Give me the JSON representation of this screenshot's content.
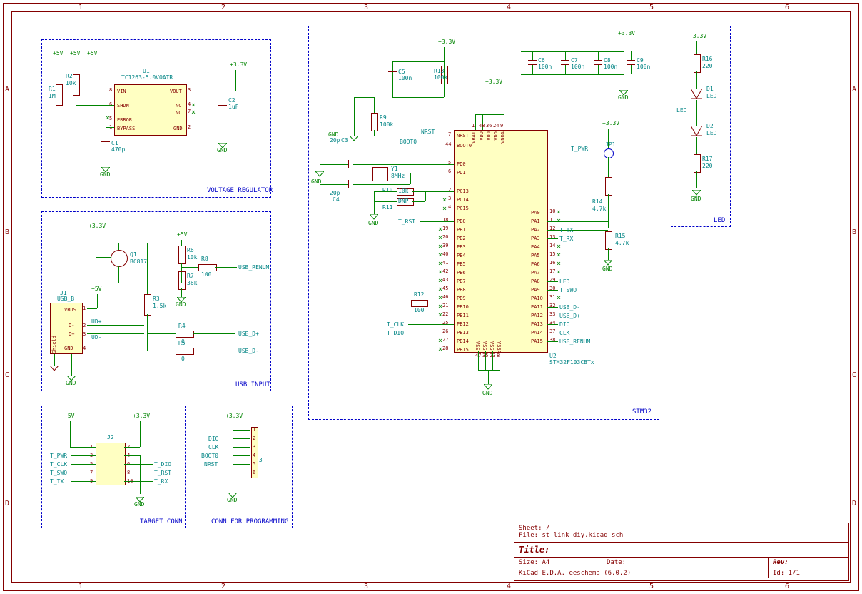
{
  "ruler": {
    "cols": [
      "1",
      "2",
      "3",
      "4",
      "5",
      "6"
    ],
    "rows": [
      "A",
      "B",
      "C",
      "D"
    ]
  },
  "blocks": {
    "vreg": "VOLTAGE REGULATOR",
    "usb": "USB INPUT",
    "target": "TARGET CONN",
    "prog": "CONN FOR PROGRAMMING",
    "stm32": "STM32",
    "led": "LED"
  },
  "power": {
    "v5": "+5V",
    "v33": "+3.3V",
    "gnd": "GND"
  },
  "vreg": {
    "u1_ref": "U1",
    "u1_val": "TC1263-5.0VOATR",
    "r1_ref": "R1",
    "r1_val": "1M",
    "r2_ref": "R2",
    "r2_val": "10k",
    "c1_ref": "C1",
    "c1_val": "470p",
    "c2_ref": "C2",
    "c2_val": "1uF",
    "pins": {
      "vin": "VIN",
      "vout": "VOUT",
      "shdn": "SHDN",
      "nc": "NC",
      "err": "ERROR",
      "byp": "BYPASS",
      "gnd": "GND"
    }
  },
  "usb": {
    "j1_ref": "J1",
    "j1_val": "USB_B",
    "q1_ref": "Q1",
    "q1_val": "BC817",
    "r3_ref": "R3",
    "r3_val": "1.5k",
    "r4_ref": "R4",
    "r4_val": "0",
    "r5_ref": "R5",
    "r5_val": "0",
    "r6_ref": "R6",
    "r6_val": "10k",
    "r7_ref": "R7",
    "r7_val": "36k",
    "r8_ref": "R8",
    "r8_val": "100",
    "vbus": "VBUS",
    "dplus": "D+",
    "dminus": "D-",
    "shield": "Shield",
    "gndpin": "GND",
    "udp": "UD+",
    "udm": "UD-",
    "renum": "USB_RENUM",
    "usbdp": "USB_D+",
    "usbdm": "USB_D-"
  },
  "target": {
    "j2_ref": "J2",
    "left": [
      "T_PWR",
      "T_CLK",
      "T_SWO",
      "T_TX"
    ],
    "right": [
      "T_DIO",
      "T_RST",
      "T_RX"
    ],
    "pins_l": [
      "1",
      "3",
      "5",
      "7",
      "9"
    ],
    "pins_r": [
      "2",
      "4",
      "6",
      "8",
      "10"
    ]
  },
  "prog": {
    "j3_ref": "J3",
    "labels": [
      "DIO",
      "CLK",
      "BOOT0",
      "NRST"
    ],
    "pins": [
      "1",
      "2",
      "3",
      "4",
      "5",
      "6"
    ]
  },
  "stm32": {
    "u2_ref": "U2",
    "u2_val": "STM32F103CBTx",
    "c3_ref": "C3",
    "c3_val": "20p",
    "c4_ref": "C4",
    "c4_val": "20p",
    "c5_ref": "C5",
    "c5_val": "100n",
    "c6_ref": "C6",
    "c6_val": "100n",
    "c7_ref": "C7",
    "c7_val": "100n",
    "c8_ref": "C8",
    "c8_val": "100n",
    "c9_ref": "C9",
    "c9_val": "100n",
    "r9_ref": "R9",
    "r9_val": "100k",
    "r10_ref": "R10",
    "r10_val": "10k",
    "r11_ref": "R11",
    "r11_val": "DNP",
    "r12_ref": "R12",
    "r12_val": "100",
    "r13_ref": "R13",
    "r13_val": "100k",
    "r14_ref": "R14",
    "r14_val": "4.7k",
    "r15_ref": "R15",
    "r15_val": "4.7k",
    "y1_ref": "Y1",
    "y1_val": "8MHz",
    "jp1_ref": "JP1",
    "nrst": "NRST",
    "boot0": "BOOT0",
    "vbat": "VBAT",
    "vdd": "VDD",
    "vdda": "VDDA",
    "vss": "VSS",
    "vssa": "VSSA",
    "pd0": "PD0",
    "pd1": "PD1",
    "pc13": "PC13",
    "pc14": "PC14",
    "pc15": "PC15",
    "pb": [
      "PB0",
      "PB1",
      "PB2",
      "PB3",
      "PB4",
      "PB5",
      "PB6",
      "PB7",
      "PB8",
      "PB9",
      "PB10",
      "PB11",
      "PB12",
      "PB13",
      "PB14",
      "PB15"
    ],
    "pa": [
      "PA0",
      "PA1",
      "PA2",
      "PA3",
      "PA4",
      "PA5",
      "PA6",
      "PA7",
      "PA8",
      "PA9",
      "PA10",
      "PA11",
      "PA12",
      "PA13",
      "PA14",
      "PA15"
    ],
    "left_nets": [
      "T_RST",
      "",
      "",
      "",
      "",
      "",
      "",
      "",
      "",
      "",
      "",
      "",
      "T_CLK",
      "T_DIO",
      "",
      ""
    ],
    "right_nets": [
      "",
      "",
      "T_TX",
      "T_RX",
      "",
      "",
      "",
      "",
      "LED",
      "T_SWO",
      "",
      "USB_D-",
      "USB_D+",
      "DIO",
      "CLK",
      "USB_RENUM"
    ],
    "tpwr": "T_PWR",
    "pb_pins": [
      "18",
      "19",
      "20",
      "39",
      "40",
      "41",
      "42",
      "43",
      "45",
      "46",
      "21",
      "22",
      "25",
      "26",
      "27",
      "28"
    ],
    "pa_pins": [
      "10",
      "11",
      "12",
      "13",
      "14",
      "15",
      "16",
      "17",
      "29",
      "30",
      "31",
      "32",
      "33",
      "34",
      "37",
      "38"
    ],
    "top_pins": [
      "1",
      "48",
      "36",
      "24",
      "9"
    ],
    "bot_pins": [
      "47",
      "35",
      "23",
      "8"
    ]
  },
  "led": {
    "r16_ref": "R16",
    "r16_val": "220",
    "r17_ref": "R17",
    "r17_val": "220",
    "d1_ref": "D1",
    "d1_val": "LED",
    "d2_ref": "D2",
    "d2_val": "LED",
    "ledlbl": "LED"
  },
  "title": {
    "sheet": "Sheet: /",
    "file": "File: st_link_diy.kicad_sch",
    "title": "Title:",
    "size": "Size: A4",
    "date": "Date:",
    "rev": "Rev:",
    "gen": "KiCad E.D.A.  eeschema (6.0.2)",
    "id": "Id: 1/1"
  }
}
